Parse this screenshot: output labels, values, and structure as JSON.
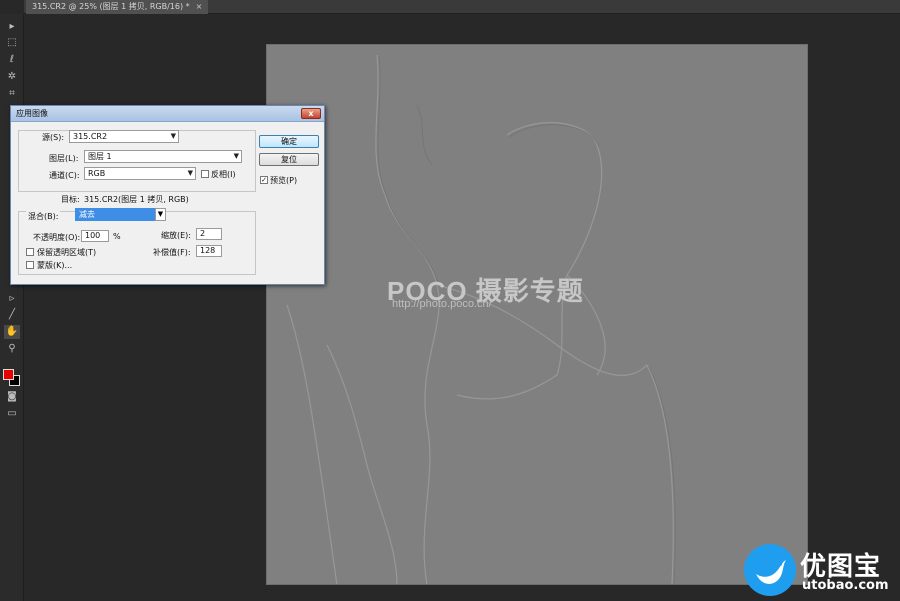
{
  "document_tab": {
    "title": "315.CR2 @ 25% (图层 1 拷贝, RGB/16) *",
    "close": "×"
  },
  "toolbar": {
    "tools": [
      {
        "name": "move-icon",
        "glyph": "▸"
      },
      {
        "name": "marquee-icon",
        "glyph": "⬚"
      },
      {
        "name": "lasso-icon",
        "glyph": "ℓ"
      },
      {
        "name": "magic-wand-icon",
        "glyph": "✲"
      },
      {
        "name": "crop-icon",
        "glyph": "⌗"
      },
      {
        "name": "path-select-icon",
        "glyph": "▹"
      },
      {
        "name": "line-icon",
        "glyph": "╱"
      },
      {
        "name": "hand-icon",
        "glyph": "✋"
      },
      {
        "name": "zoom-icon",
        "glyph": "⚲"
      },
      {
        "name": "quick-mask-icon",
        "glyph": "◙"
      },
      {
        "name": "screen-mode-icon",
        "glyph": "▭"
      }
    ],
    "foreground_color": "#e60000",
    "background_color": "#000000"
  },
  "dialog": {
    "title": "应用图像",
    "close": "x",
    "source_label": "源(S):",
    "source_value": "315.CR2",
    "layer_label": "图层(L):",
    "layer_value": "图层 1",
    "channel_label": "通道(C):",
    "channel_value": "RGB",
    "invert_label": "反相(I)",
    "target_label": "目标:",
    "target_value": "315.CR2(图层 1 拷贝, RGB)",
    "blend_label": "混合(B):",
    "blend_value": "减去",
    "opacity_label": "不透明度(O):",
    "opacity_value": "100",
    "opacity_unit": "%",
    "scale_label": "缩放(E):",
    "scale_value": "2",
    "preserve_label": "保留透明区域(T)",
    "offset_label": "补偿值(F):",
    "offset_value": "128",
    "mask_label": "蒙版(K)...",
    "ok_label": "确定",
    "reset_label": "复位",
    "preview_label": "预览(P)",
    "preview_checked": "✓"
  },
  "canvas_watermark": {
    "brand": "POCO 摄影专题",
    "url": "http://photo.poco.cn/"
  },
  "site_logo": {
    "text": "优图宝",
    "url": "utobao.com"
  }
}
